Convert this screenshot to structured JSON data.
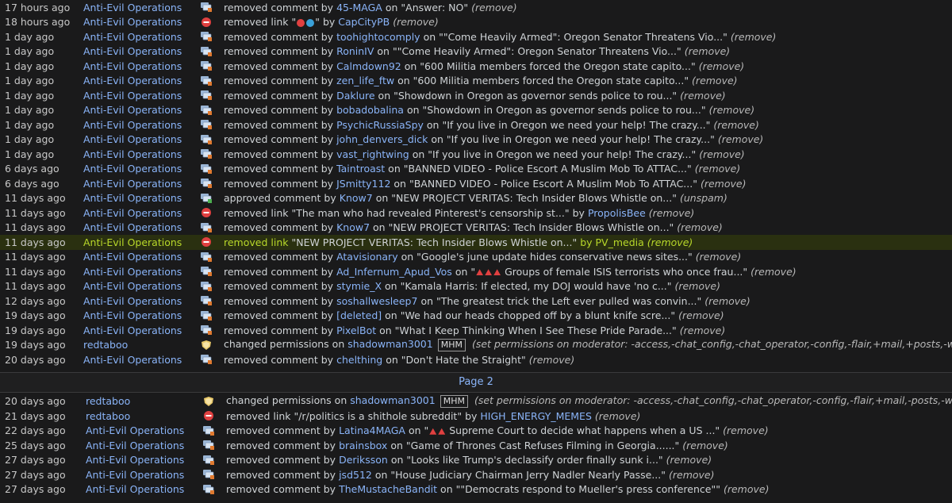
{
  "colors": {
    "mod_link": "#8ab4f8",
    "background": "#1a1a1b",
    "highlight_row": "#2a3010",
    "remove_icon": "#e04040"
  },
  "page_label": "Page 2",
  "page1": [
    {
      "time": "17 hours ago",
      "mod": "Anti-Evil Operations",
      "icon": "comment-removed-icon",
      "verb": "removed comment",
      "by": "by",
      "user": "45-MAGA",
      "on": "on",
      "target": "\"Answer: NO\"",
      "note": "(remove)"
    },
    {
      "time": "18 hours ago",
      "mod": "Anti-Evil Operations",
      "icon": "link-removed-icon",
      "verb": "removed link",
      "target_pre": "\"",
      "target_post": "\"",
      "by": "by",
      "user": "CapCityPB",
      "note": "(remove)",
      "emoji": true
    },
    {
      "time": "1 day ago",
      "mod": "Anti-Evil Operations",
      "icon": "comment-removed-icon",
      "verb": "removed comment",
      "by": "by",
      "user": "toohightocomply",
      "on": "on",
      "target": "\"\"Come Heavily Armed\": Oregon Senator Threatens Vio...\"",
      "note": "(remove)"
    },
    {
      "time": "1 day ago",
      "mod": "Anti-Evil Operations",
      "icon": "comment-removed-icon",
      "verb": "removed comment",
      "by": "by",
      "user": "RoninIV",
      "on": "on",
      "target": "\"\"Come Heavily Armed\": Oregon Senator Threatens Vio...\"",
      "note": "(remove)"
    },
    {
      "time": "1 day ago",
      "mod": "Anti-Evil Operations",
      "icon": "comment-removed-icon",
      "verb": "removed comment",
      "by": "by",
      "user": "Calmdown92",
      "on": "on",
      "target": "\"600 Militia members forced the Oregon state capito...\"",
      "note": "(remove)"
    },
    {
      "time": "1 day ago",
      "mod": "Anti-Evil Operations",
      "icon": "comment-removed-icon",
      "verb": "removed comment",
      "by": "by",
      "user": "zen_life_ftw",
      "on": "on",
      "target": "\"600 Militia members forced the Oregon state capito...\"",
      "note": "(remove)"
    },
    {
      "time": "1 day ago",
      "mod": "Anti-Evil Operations",
      "icon": "comment-removed-icon",
      "verb": "removed comment",
      "by": "by",
      "user": "Daklure",
      "on": "on",
      "target": "\"Showdown in Oregon as governor sends police to rou...\"",
      "note": "(remove)"
    },
    {
      "time": "1 day ago",
      "mod": "Anti-Evil Operations",
      "icon": "comment-removed-icon",
      "verb": "removed comment",
      "by": "by",
      "user": "bobadobalina",
      "on": "on",
      "target": "\"Showdown in Oregon as governor sends police to rou...\"",
      "note": "(remove)"
    },
    {
      "time": "1 day ago",
      "mod": "Anti-Evil Operations",
      "icon": "comment-removed-icon",
      "verb": "removed comment",
      "by": "by",
      "user": "PsychicRussiaSpy",
      "on": "on",
      "target": "\"If you live in Oregon we need your help! The crazy...\"",
      "note": "(remove)"
    },
    {
      "time": "1 day ago",
      "mod": "Anti-Evil Operations",
      "icon": "comment-removed-icon",
      "verb": "removed comment",
      "by": "by",
      "user": "john_denvers_dick",
      "on": "on",
      "target": "\"If you live in Oregon we need your help! The crazy...\"",
      "note": "(remove)"
    },
    {
      "time": "1 day ago",
      "mod": "Anti-Evil Operations",
      "icon": "comment-removed-icon",
      "verb": "removed comment",
      "by": "by",
      "user": "vast_rightwing",
      "on": "on",
      "target": "\"If you live in Oregon we need your help! The crazy...\"",
      "note": "(remove)"
    },
    {
      "time": "6 days ago",
      "mod": "Anti-Evil Operations",
      "icon": "comment-removed-icon",
      "verb": "removed comment",
      "by": "by",
      "user": "Taintroast",
      "on": "on",
      "target": "\"BANNED VIDEO - Police Escort A Muslim Mob To ATTAC...\"",
      "note": "(remove)"
    },
    {
      "time": "6 days ago",
      "mod": "Anti-Evil Operations",
      "icon": "comment-removed-icon",
      "verb": "removed comment",
      "by": "by",
      "user": "JSmitty112",
      "on": "on",
      "target": "\"BANNED VIDEO - Police Escort A Muslim Mob To ATTAC...\"",
      "note": "(remove)"
    },
    {
      "time": "11 days ago",
      "mod": "Anti-Evil Operations",
      "icon": "comment-approved-icon",
      "verb": "approved comment",
      "by": "by",
      "user": "Know7",
      "on": "on",
      "target": "\"NEW PROJECT VERITAS: Tech Insider Blows Whistle on...\"",
      "note": "(unspam)"
    },
    {
      "time": "11 days ago",
      "mod": "Anti-Evil Operations",
      "icon": "link-removed-icon",
      "verb": "removed link",
      "target": "\"The man who had revealed Pinterest's censorship st...\"",
      "by": "by",
      "user": "PropolisBee",
      "note": "(remove)",
      "link": true
    },
    {
      "time": "11 days ago",
      "mod": "Anti-Evil Operations",
      "icon": "comment-removed-icon",
      "verb": "removed comment",
      "by": "by",
      "user": "Know7",
      "on": "on",
      "target": "\"NEW PROJECT VERITAS: Tech Insider Blows Whistle on...\"",
      "note": "(remove)"
    },
    {
      "time": "11 days ago",
      "mod": "Anti-Evil Operations",
      "icon": "link-removed-icon",
      "verb": "removed link",
      "target": "\"NEW PROJECT VERITAS: Tech Insider Blows Whistle on...\"",
      "by": "by",
      "user": "PV_media",
      "note": "(remove)",
      "link": true,
      "highlight": true
    },
    {
      "time": "11 days ago",
      "mod": "Anti-Evil Operations",
      "icon": "comment-removed-icon",
      "verb": "removed comment",
      "by": "by",
      "user": "Atavisionary",
      "on": "on",
      "target": "\"Google's june update hides conservative news sites...\"",
      "note": "(remove)"
    },
    {
      "time": "11 days ago",
      "mod": "Anti-Evil Operations",
      "icon": "comment-removed-icon",
      "verb": "removed comment",
      "by": "by",
      "user": "Ad_Infernum_Apud_Vos",
      "on": "on",
      "target_pre": "\"",
      "target": "Groups of female ISIS terrorists who once frau...\"",
      "note": "(remove)",
      "flags": 3
    },
    {
      "time": "11 days ago",
      "mod": "Anti-Evil Operations",
      "icon": "comment-removed-icon",
      "verb": "removed comment",
      "by": "by",
      "user": "stymie_X",
      "on": "on",
      "target": "\"Kamala Harris: If elected, my DOJ would have 'no c...\"",
      "note": "(remove)"
    },
    {
      "time": "12 days ago",
      "mod": "Anti-Evil Operations",
      "icon": "comment-removed-icon",
      "verb": "removed comment",
      "by": "by",
      "user": "soshallwesleep7",
      "on": "on",
      "target": "\"The greatest trick the Left ever pulled was convin...\"",
      "note": "(remove)"
    },
    {
      "time": "19 days ago",
      "mod": "Anti-Evil Operations",
      "icon": "comment-removed-icon",
      "verb": "removed comment",
      "by": "by",
      "user": "[deleted]",
      "on": "on",
      "target": "\"We had our heads chopped off by a blunt knife scre...\"",
      "note": "(remove)"
    },
    {
      "time": "19 days ago",
      "mod": "Anti-Evil Operations",
      "icon": "comment-removed-icon",
      "verb": "removed comment",
      "by": "by",
      "user": "PixelBot",
      "on": "on",
      "target": "\"What I Keep Thinking When I See These Pride Parade...\"",
      "note": "(remove)"
    },
    {
      "time": "19 days ago",
      "mod": "redtaboo",
      "icon": "permissions-icon",
      "verb": "changed permissions",
      "on": "on",
      "user": "shadowman3001",
      "badge": "MHM",
      "note": "(set permissions on moderator: -access,-chat_config,-chat_operator,-config,-flair,+mail,+posts,-wiki)",
      "perm": true
    },
    {
      "time": "20 days ago",
      "mod": "Anti-Evil Operations",
      "icon": "comment-removed-icon",
      "verb": "removed comment",
      "by": "by",
      "user": "chelthing",
      "on": "on",
      "target": "\"Don't Hate the Straight\"",
      "note": "(remove)"
    }
  ],
  "page2": [
    {
      "time": "20 days ago",
      "mod": "redtaboo",
      "icon": "permissions-icon",
      "verb": "changed permissions",
      "on": "on",
      "user": "shadowman3001",
      "badge": "MHM",
      "note": "(set permissions on moderator: -access,-chat_config,-chat_operator,-config,-flair,+mail,-posts,-wiki)",
      "perm": true
    },
    {
      "time": "21 days ago",
      "mod": "redtaboo",
      "icon": "link-removed-icon",
      "verb": "removed link",
      "target": "\"/r/politics is a shithole subreddit\"",
      "by": "by",
      "user": "HIGH_ENERGY_MEMES",
      "note": "(remove)",
      "link": true
    },
    {
      "time": "22 days ago",
      "mod": "Anti-Evil Operations",
      "icon": "comment-removed-icon",
      "verb": "removed comment",
      "by": "by",
      "user": "Latina4MAGA",
      "on": "on",
      "target_pre": "\"",
      "target": "Supreme Court to decide what happens when a US ...\"",
      "note": "(remove)",
      "flags": 2
    },
    {
      "time": "25 days ago",
      "mod": "Anti-Evil Operations",
      "icon": "comment-removed-icon",
      "verb": "removed comment",
      "by": "by",
      "user": "brainsbox",
      "on": "on",
      "target": "\"Game of Thrones Cast Refuses Filming in Georgia......\"",
      "note": "(remove)"
    },
    {
      "time": "27 days ago",
      "mod": "Anti-Evil Operations",
      "icon": "comment-removed-icon",
      "verb": "removed comment",
      "by": "by",
      "user": "Deriksson",
      "on": "on",
      "target": "\"Looks like Trump's declassify order finally sunk i...\"",
      "note": "(remove)"
    },
    {
      "time": "27 days ago",
      "mod": "Anti-Evil Operations",
      "icon": "comment-removed-icon",
      "verb": "removed comment",
      "by": "by",
      "user": "jsd512",
      "on": "on",
      "target": "\"House Judiciary Chairman Jerry Nadler Nearly Passe...\"",
      "note": "(remove)"
    },
    {
      "time": "27 days ago",
      "mod": "Anti-Evil Operations",
      "icon": "comment-removed-icon",
      "verb": "removed comment",
      "by": "by",
      "user": "TheMustacheBandit",
      "on": "on",
      "target": "\"\"Democrats respond to Mueller's press conference\"\"",
      "note": "(remove)"
    }
  ]
}
